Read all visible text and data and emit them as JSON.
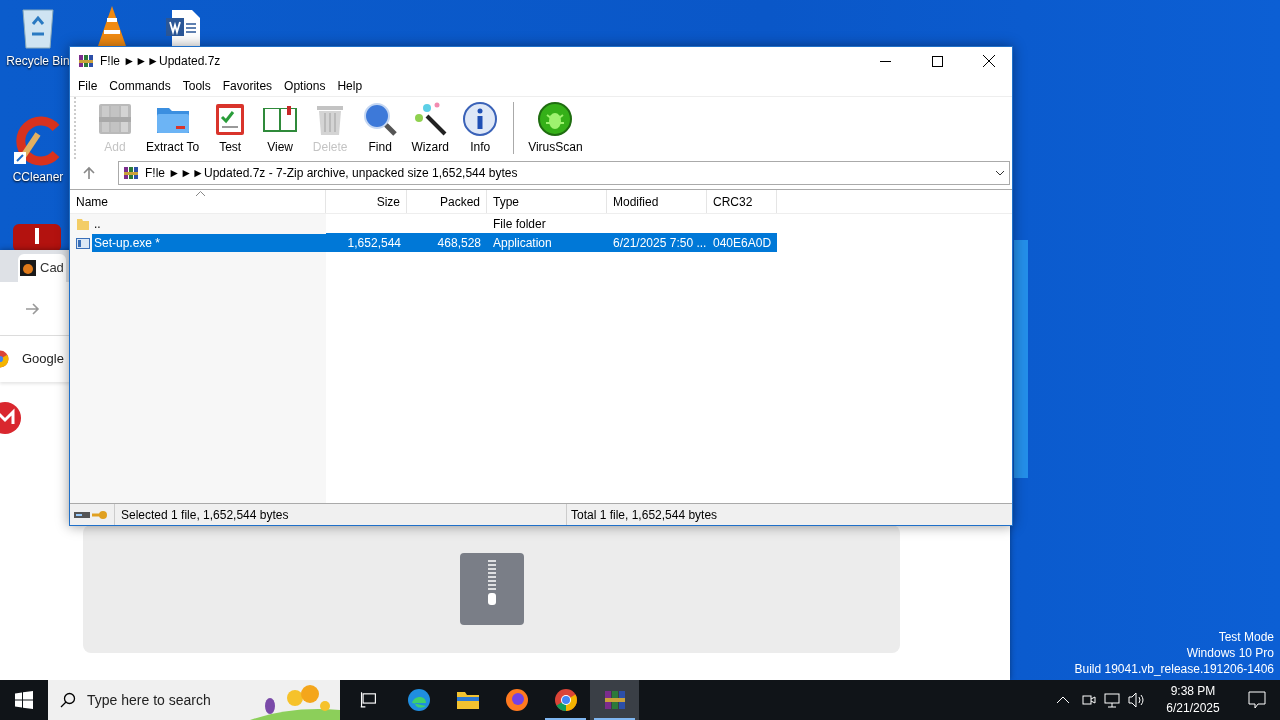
{
  "desktop_icons": [
    {
      "kind": "recycle",
      "label": "Recycle Bin"
    },
    {
      "kind": "ccleaner",
      "label": "CCleaner"
    }
  ],
  "browser": {
    "tab_title": "Cad",
    "bookmark": "Google"
  },
  "archive_window": {
    "title": "F!le ►►►Updated.7z",
    "menu": [
      "File",
      "Commands",
      "Tools",
      "Favorites",
      "Options",
      "Help"
    ],
    "toolbar": [
      {
        "kind": "add",
        "label": "Add",
        "disabled": true
      },
      {
        "kind": "extract",
        "label": "Extract To",
        "disabled": false
      },
      {
        "kind": "test",
        "label": "Test",
        "disabled": false
      },
      {
        "kind": "view",
        "label": "View",
        "disabled": false
      },
      {
        "kind": "delete",
        "label": "Delete",
        "disabled": true
      },
      {
        "kind": "find",
        "label": "Find",
        "disabled": false
      },
      {
        "kind": "wizard",
        "label": "Wizard",
        "disabled": false
      },
      {
        "kind": "info",
        "label": "Info",
        "disabled": false
      },
      {
        "kind": "virusscan",
        "label": "VirusScan",
        "disabled": false
      }
    ],
    "address": "F!le ►►►Updated.7z - 7-Zip archive, unpacked size 1,652,544 bytes",
    "columns": [
      "Name",
      "Size",
      "Packed",
      "Type",
      "Modified",
      "CRC32"
    ],
    "rows": [
      {
        "kind": "folder",
        "name": "..",
        "type": "File folder",
        "selected": false
      },
      {
        "kind": "file",
        "name": "Set-up.exe *",
        "size": "1,652,544",
        "packed": "468,528",
        "type": "Application",
        "modified": "6/21/2025 7:50 ...",
        "crc32": "040E6A0D",
        "selected": true
      }
    ],
    "status_left": "Selected 1 file, 1,652,544 bytes",
    "status_right": "Total 1 file, 1,652,544 bytes"
  },
  "system_watermark": [
    "Test Mode",
    "Windows 10 Pro",
    "Build 19041.vb_release.191206-1406"
  ],
  "taskbar": {
    "search_placeholder": "Type here to search",
    "apps": [
      {
        "kind": "taskview",
        "open": false,
        "active": false
      },
      {
        "kind": "edge",
        "open": false,
        "active": false
      },
      {
        "kind": "explorer",
        "open": false,
        "active": false
      },
      {
        "kind": "firefox",
        "open": false,
        "active": false
      },
      {
        "kind": "chrome",
        "open": true,
        "active": false
      },
      {
        "kind": "winrar",
        "open": true,
        "active": true
      }
    ],
    "time": "9:38 PM",
    "date": "6/21/2025"
  }
}
